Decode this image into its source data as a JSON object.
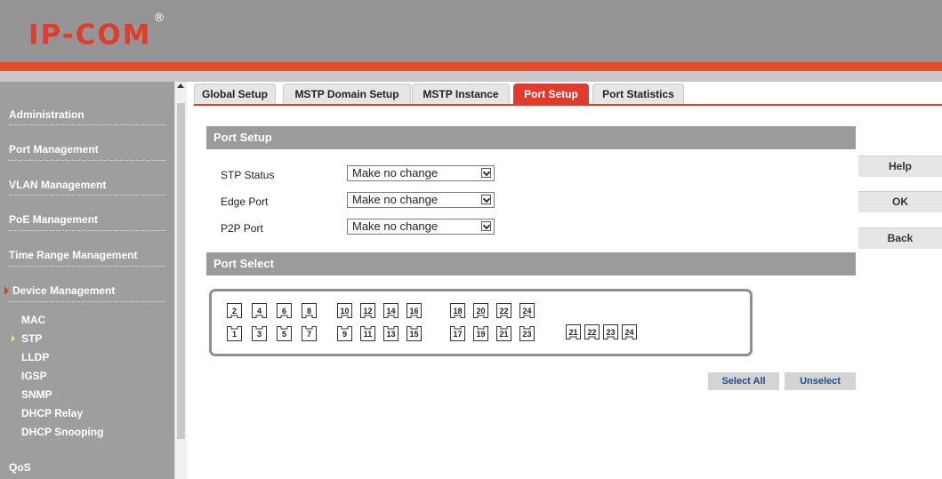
{
  "brand": {
    "logo_text": "IP-COM",
    "registered": "®"
  },
  "sidebar": {
    "items": [
      {
        "label": "Administration"
      },
      {
        "label": "Port Management"
      },
      {
        "label": "VLAN Management"
      },
      {
        "label": "PoE Management"
      },
      {
        "label": "Time Range Management"
      },
      {
        "label": "Device Management",
        "expanded": true
      }
    ],
    "subitems": [
      {
        "label": "MAC"
      },
      {
        "label": "STP",
        "selected": true
      },
      {
        "label": "LLDP"
      },
      {
        "label": "IGSP"
      },
      {
        "label": "SNMP"
      },
      {
        "label": "DHCP Relay"
      },
      {
        "label": "DHCP Snooping"
      }
    ],
    "bottom_item": {
      "label": "QoS"
    }
  },
  "tabs": [
    {
      "label": "Global Setup"
    },
    {
      "label": "MSTP Domain Setup"
    },
    {
      "label": "MSTP Instance"
    },
    {
      "label": "Port Setup",
      "active": true
    },
    {
      "label": "Port Statistics"
    }
  ],
  "port_setup": {
    "title": "Port Setup",
    "fields": [
      {
        "label": "STP Status",
        "value": "Make no change"
      },
      {
        "label": "Edge Port",
        "value": "Make no change"
      },
      {
        "label": "P2P Port",
        "value": "Make no change"
      }
    ]
  },
  "port_select": {
    "title": "Port Select",
    "top_row": [
      "2",
      "4",
      "6",
      "8",
      "10",
      "12",
      "14",
      "16",
      "18",
      "20",
      "22",
      "24"
    ],
    "bottom_row": [
      "1",
      "3",
      "5",
      "7",
      "9",
      "11",
      "13",
      "15",
      "17",
      "19",
      "21",
      "23"
    ],
    "uplink_ports": [
      "21",
      "22",
      "23",
      "24"
    ]
  },
  "actions": {
    "help": "Help",
    "ok": "OK",
    "back": "Back",
    "select_all": "Select All",
    "unselect": "Unselect"
  },
  "colors": {
    "accent": "#e23b2b",
    "header": "#959595",
    "sidebar": "#9e9e9e",
    "section": "#9b9b9b",
    "link": "#1f4e8c"
  }
}
